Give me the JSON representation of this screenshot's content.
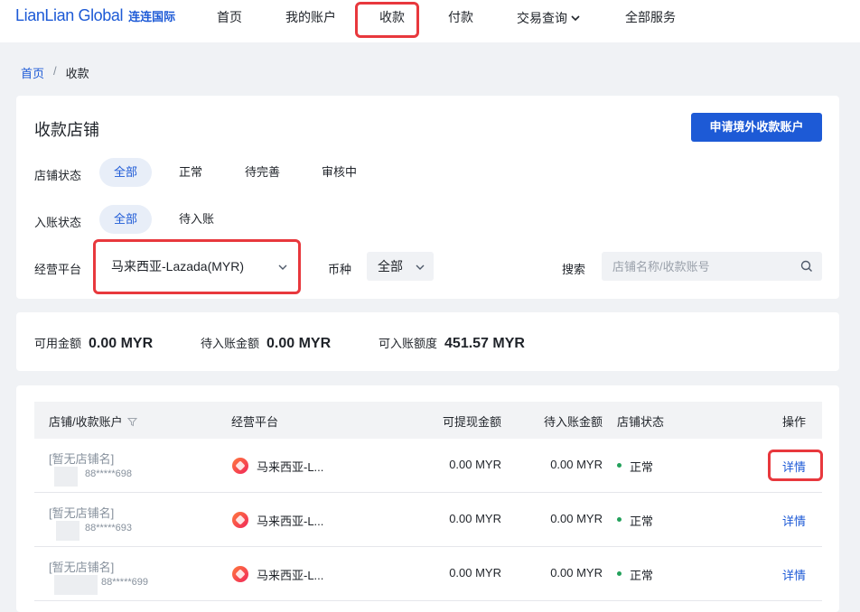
{
  "brand": {
    "name_en": "LianLian Global",
    "name_cn": "连连国际"
  },
  "nav": {
    "items": [
      {
        "label": "首页"
      },
      {
        "label": "我的账户"
      },
      {
        "label": "收款",
        "active": true
      },
      {
        "label": "付款"
      },
      {
        "label": "交易查询",
        "icon": "chevron-down-icon"
      },
      {
        "label": "全部服务"
      }
    ]
  },
  "breadcrumb": {
    "home": "首页",
    "separator": "/",
    "current": "收款"
  },
  "page": {
    "title": "收款店铺",
    "apply_button": "申请境外收款账户"
  },
  "filters": {
    "store_status": {
      "label": "店铺状态",
      "options": [
        "全部",
        "正常",
        "待完善",
        "审核中"
      ],
      "selected": "全部"
    },
    "entry_status": {
      "label": "入账状态",
      "options": [
        "全部",
        "待入账"
      ],
      "selected": "全部"
    },
    "platform": {
      "label": "经营平台",
      "value": "马来西亚-Lazada(MYR)"
    },
    "currency": {
      "label": "币种",
      "value": "全部"
    },
    "search": {
      "label": "搜索",
      "placeholder": "店铺名称/收款账号",
      "icon": "search-icon"
    }
  },
  "summary": {
    "available": {
      "label": "可用金额",
      "value": "0.00 MYR"
    },
    "pending": {
      "label": "待入账金额",
      "value": "0.00 MYR"
    },
    "limit": {
      "label": "可入账额度",
      "value": "451.57 MYR"
    }
  },
  "table": {
    "headers": [
      "店铺/收款账户",
      "经营平台",
      "可提现金额",
      "待入账金额",
      "店铺状态",
      "操作"
    ],
    "rows": [
      {
        "store": "[暂无店铺名]",
        "account": "88*****698",
        "platform": "马来西亚-L...",
        "withdrawable": "0.00 MYR",
        "pending": "0.00 MYR",
        "status": "正常",
        "action": "详情"
      },
      {
        "store": "[暂无店铺名]",
        "account": "88*****693",
        "platform": "马来西亚-L...",
        "withdrawable": "0.00 MYR",
        "pending": "0.00 MYR",
        "status": "正常",
        "action": "详情"
      },
      {
        "store": "[暂无店铺名]",
        "account": "88*****699",
        "platform": "马来西亚-L...",
        "withdrawable": "0.00 MYR",
        "pending": "0.00 MYR",
        "status": "正常",
        "action": "详情"
      }
    ]
  },
  "colors": {
    "brand": "#1d5ad6",
    "highlight": "#e8383d",
    "status_ok": "#23a15b"
  }
}
